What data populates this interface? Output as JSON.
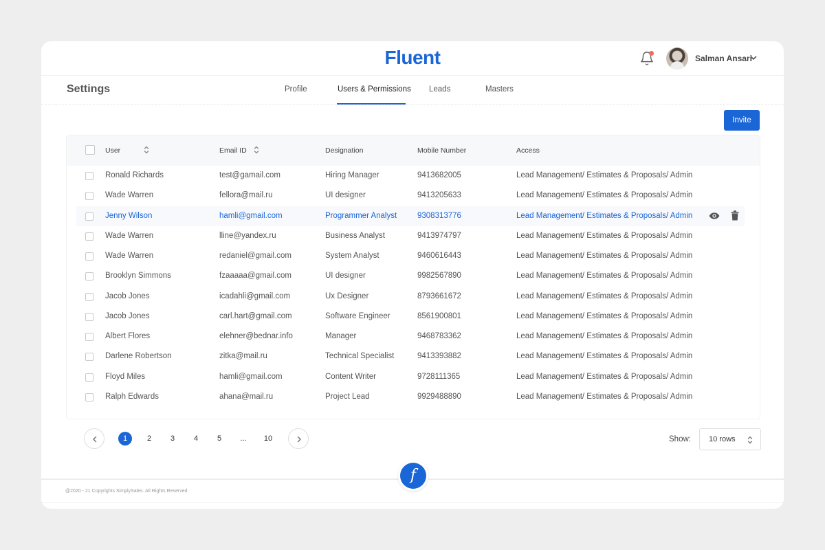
{
  "header": {
    "logo": "Fluent",
    "user_name": "Salman Ansari"
  },
  "settings": {
    "title": "Settings",
    "tabs": [
      {
        "label": "Profile",
        "active": false
      },
      {
        "label": "Users & Permissions",
        "active": true
      },
      {
        "label": "Leads",
        "active": false
      },
      {
        "label": "Masters",
        "active": false
      }
    ],
    "invite_label": "Invite"
  },
  "table": {
    "headers": {
      "user": "User",
      "email": "Email ID",
      "designation": "Designation",
      "mobile": "Mobile Number",
      "access": "Access"
    },
    "rows": [
      {
        "user": "Ronald Richards",
        "email": "test@gamail.com",
        "designation": "Hiring Manager",
        "mobile": "9413682005",
        "access": "Lead Management/ Estimates & Proposals/ Admin"
      },
      {
        "user": "Wade Warren",
        "email": "fellora@mail.ru",
        "designation": "UI designer",
        "mobile": "9413205633",
        "access": "Lead Management/ Estimates & Proposals/ Admin"
      },
      {
        "user": "Jenny Wilson",
        "email": "hamli@gmail.com",
        "designation": "Programmer Analyst",
        "mobile": "9308313776",
        "access": "Lead Management/ Estimates & Proposals/ Admin"
      },
      {
        "user": "Wade Warren",
        "email": "lline@yandex.ru",
        "designation": "Business Analyst",
        "mobile": "9413974797",
        "access": "Lead Management/ Estimates & Proposals/ Admin"
      },
      {
        "user": "Wade Warren",
        "email": "redaniel@gmail.com",
        "designation": "System Analyst",
        "mobile": "9460616443",
        "access": "Lead Management/ Estimates & Proposals/ Admin"
      },
      {
        "user": "Brooklyn Simmons",
        "email": "fzaaaaa@gmail.com",
        "designation": "UI designer",
        "mobile": "9982567890",
        "access": "Lead Management/ Estimates & Proposals/ Admin"
      },
      {
        "user": "Jacob Jones",
        "email": "icadahli@gmail.com",
        "designation": "Ux Designer",
        "mobile": "8793661672",
        "access": "Lead Management/ Estimates & Proposals/ Admin"
      },
      {
        "user": "Jacob Jones",
        "email": "carl.hart@gmail.com",
        "designation": "Software Engineer",
        "mobile": "8561900801",
        "access": "Lead Management/ Estimates & Proposals/ Admin"
      },
      {
        "user": "Albert Flores",
        "email": "elehner@bednar.info",
        "designation": "Manager",
        "mobile": "9468783362",
        "access": "Lead Management/ Estimates & Proposals/ Admin"
      },
      {
        "user": "Darlene Robertson",
        "email": "zitka@mail.ru",
        "designation": "Technical Specialist",
        "mobile": "9413393882",
        "access": "Lead Management/ Estimates & Proposals/ Admin"
      },
      {
        "user": "Floyd Miles",
        "email": "hamli@gmail.com",
        "designation": "Content Writer",
        "mobile": "9728111365",
        "access": "Lead Management/ Estimates & Proposals/ Admin"
      },
      {
        "user": "Ralph Edwards",
        "email": "ahana@mail.ru",
        "designation": "Project Lead",
        "mobile": "9929488890",
        "access": "Lead Management/ Estimates & Proposals/ Admin"
      }
    ]
  },
  "pagination": {
    "pages": [
      "1",
      "2",
      "3",
      "4",
      "5",
      "...",
      "10"
    ],
    "current": "1",
    "show_label": "Show:",
    "rows_option": "10 rows"
  },
  "footer": {
    "copyright": "@2020 - 21 Copyrights SimplySales. All Rights Reserved",
    "badge_letter": "f"
  },
  "colors": {
    "accent": "#1a66d6",
    "notification_dot": "#ef6d5b"
  }
}
